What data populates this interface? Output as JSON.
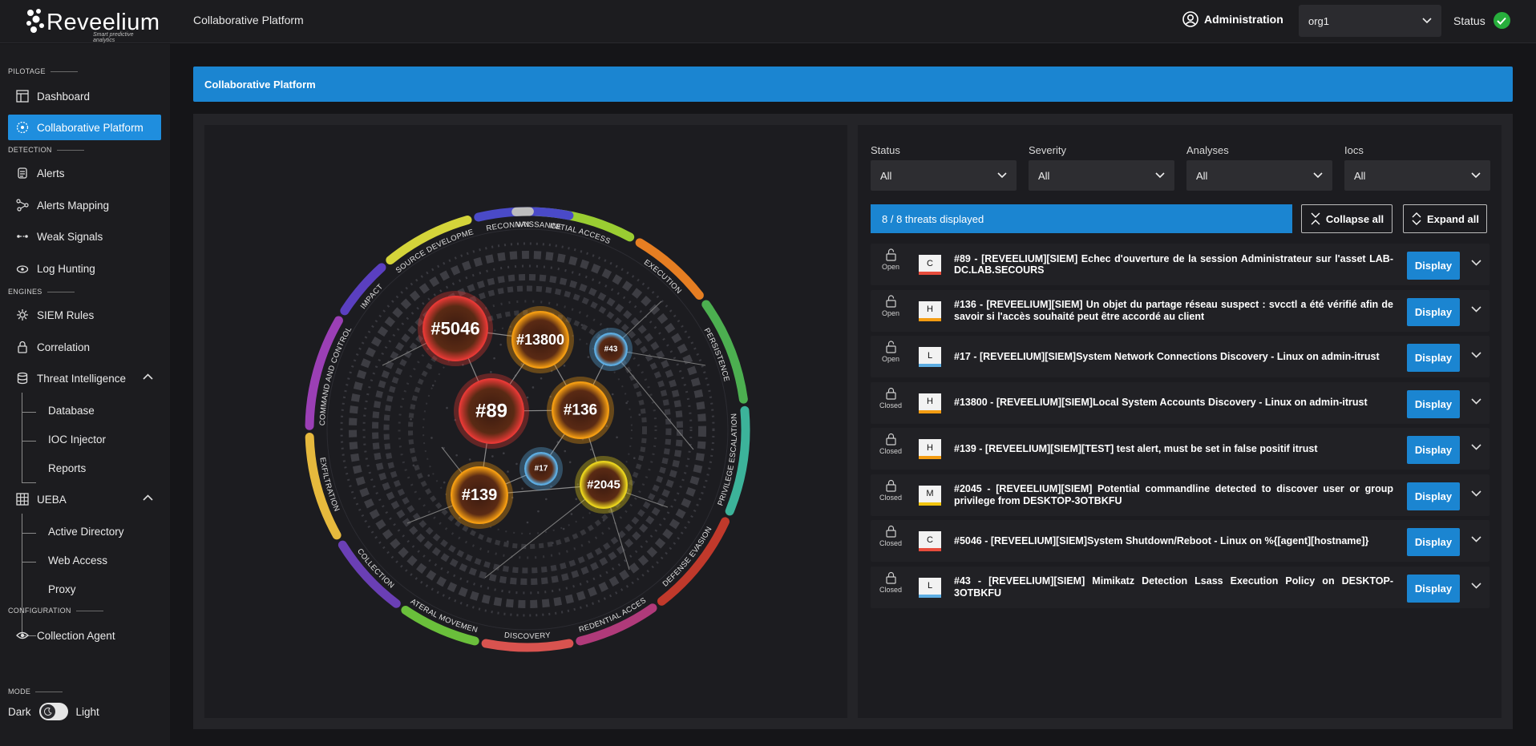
{
  "app": {
    "brand": "Reveelium",
    "tagline": "Smart predictive analytics",
    "page_name": "Collaborative Platform",
    "admin_label": "Administration",
    "org_value": "org1",
    "status_label": "Status"
  },
  "sidebar": {
    "sections": {
      "pilotage": "PILOTAGE",
      "detection": "DETECTION",
      "engines": "ENGINES",
      "configuration": "CONFIGURATION",
      "mode": "MODE"
    },
    "items": {
      "dashboard": "Dashboard",
      "collaborative": "Collaborative Platform",
      "alerts": "Alerts",
      "alerts_mapping": "Alerts Mapping",
      "weak_signals": "Weak Signals",
      "log_hunting": "Log Hunting",
      "siem_rules": "SIEM Rules",
      "correlation": "Correlation",
      "threat_intel": "Threat Intelligence",
      "database": "Database",
      "ioc_injector": "IOC Injector",
      "reports": "Reports",
      "ueba": "UEBA",
      "active_directory": "Active Directory",
      "web_access": "Web Access",
      "proxy": "Proxy",
      "collection_agent": "Collection Agent"
    },
    "mode": {
      "dark": "Dark",
      "light": "Light",
      "current": "dark"
    }
  },
  "main": {
    "header": "Collaborative Platform",
    "filters": [
      {
        "label": "Status",
        "value": "All"
      },
      {
        "label": "Severity",
        "value": "All"
      },
      {
        "label": "Analyses",
        "value": "All"
      },
      {
        "label": "Iocs",
        "value": "All"
      }
    ],
    "count_text": "8 / 8 threats displayed",
    "collapse_all": "Collapse all",
    "expand_all": "Expand all",
    "display_label": "Display",
    "threats": [
      {
        "state": "Open",
        "severity": "C",
        "sev_color": "#e74c3c",
        "title": "#89 - [REVEELIUM][SIEM] Echec d'ouverture de la session Administrateur sur l'asset LAB-DC.LAB.SECOURS"
      },
      {
        "state": "Open",
        "severity": "H",
        "sev_color": "#f39c12",
        "title": "#136 - [REVEELIUM][SIEM] Un objet du partage réseau suspect : svcctl a été vérifié afin de savoir si l'accès souhaité peut être accordé au client"
      },
      {
        "state": "Open",
        "severity": "L",
        "sev_color": "#5dade2",
        "title": "#17 - [REVEELIUM][SIEM]System Network Connections Discovery - Linux on admin-itrust"
      },
      {
        "state": "Closed",
        "severity": "H",
        "sev_color": "#f39c12",
        "title": "#13800 - [REVEELIUM][SIEM]Local System Accounts Discovery - Linux on admin-itrust"
      },
      {
        "state": "Closed",
        "severity": "H",
        "sev_color": "#f39c12",
        "title": "#139 - [REVEELIUM][SIEM][TEST] test alert, must be set in false positif itrust"
      },
      {
        "state": "Closed",
        "severity": "M",
        "sev_color": "#f1c40f",
        "title": "#2045 - [REVEELIUM][SIEM] Potential commandline detected to discover user or group privilege from DESKTOP-3OTBKFU"
      },
      {
        "state": "Closed",
        "severity": "C",
        "sev_color": "#e74c3c",
        "title": "#5046 - [REVEELIUM][SIEM]System Shutdown/Reboot - Linux on %{[agent][hostname]}"
      },
      {
        "state": "Closed",
        "severity": "L",
        "sev_color": "#5dade2",
        "title": "#43 - [REVEELIUM][SIEM] Mimikatz Detection Lsass Execution Policy on DESKTOP-3OTBKFU"
      }
    ]
  },
  "visual": {
    "tactics": [
      {
        "label": "INITIAL ACCESS",
        "color": "#9acd32"
      },
      {
        "label": "EXECUTION",
        "color": "#e67e22"
      },
      {
        "label": "PERSISTENCE",
        "color": "#4caf50"
      },
      {
        "label": "PRIVILEGE ESCALATION",
        "color": "#3cb39a"
      },
      {
        "label": "DEFENSE EVASION",
        "color": "#c0392b"
      },
      {
        "label": "CREDENTIAL ACCESS",
        "color": "#b03a7a"
      },
      {
        "label": "DISCOVERY",
        "color": "#d9534f"
      },
      {
        "label": "LATERAL MOVEMENT",
        "color": "#6abf3b"
      },
      {
        "label": "COLLECTION",
        "color": "#6a3fb5"
      },
      {
        "label": "EXFILTRATION",
        "color": "#e6b93d"
      },
      {
        "label": "COMMAND AND CONTROL",
        "color": "#9b3fb5"
      },
      {
        "label": "IMPACT",
        "color": "#5a3fc0"
      },
      {
        "label": "RESOURCE DEVELOPMENT",
        "color": "#d4d43a"
      },
      {
        "label": "RECONNAISSANCE",
        "color": "#4a4ac8"
      },
      {
        "label": "WN",
        "color": "#bdbdbd"
      }
    ],
    "bubbles": [
      {
        "label": "#5046",
        "level": "critical"
      },
      {
        "label": "#13800",
        "level": "high"
      },
      {
        "label": "#43",
        "level": "low"
      },
      {
        "label": "#89",
        "level": "critical"
      },
      {
        "label": "#136",
        "level": "high"
      },
      {
        "label": "#17",
        "level": "low"
      },
      {
        "label": "#2045",
        "level": "medium"
      },
      {
        "label": "#139",
        "level": "high"
      }
    ],
    "level_colors": {
      "critical": "#e53935",
      "high": "#f39c12",
      "medium": "#e8d21d",
      "low": "#5dade2"
    }
  }
}
